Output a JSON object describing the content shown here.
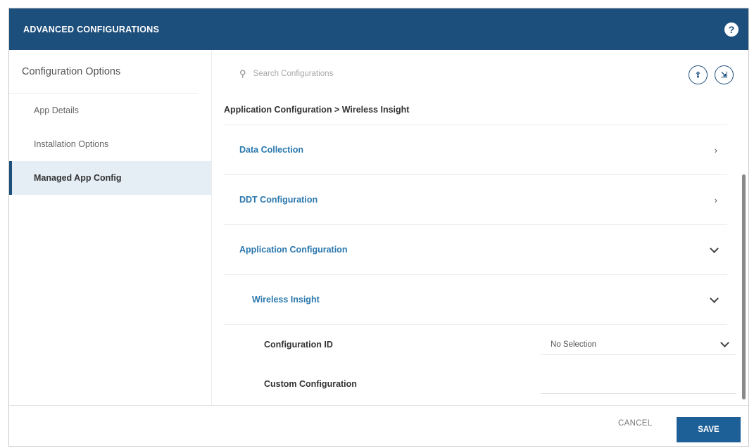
{
  "dialog": {
    "title": "ADVANCED CONFIGURATIONS",
    "help_icon": "question-circle-icon",
    "header_color": "#1d4f7c"
  },
  "sidebar": {
    "heading": "Configuration Options",
    "items": [
      {
        "label": "App Details",
        "active": false
      },
      {
        "label": "Installation Options",
        "active": false
      },
      {
        "label": "Managed App Config",
        "active": true
      }
    ]
  },
  "search": {
    "placeholder": "Search Configurations",
    "icon": "search-icon"
  },
  "toolbar": {
    "upload_icon": "upload-icon",
    "upload_glyph": "⇪",
    "export_icon": "export-icon",
    "export_glyph": "⇲"
  },
  "breadcrumb": "Application Configuration > Wireless Insight",
  "sections": [
    {
      "label": "Data Collection",
      "state": "collapsed",
      "chevron": "›"
    },
    {
      "label": "DDT Configuration",
      "state": "collapsed",
      "chevron": "›"
    },
    {
      "label": "Application Configuration",
      "state": "expanded"
    }
  ],
  "subsection": {
    "label": "Wireless Insight",
    "state": "expanded"
  },
  "fields": {
    "configuration_id": {
      "label": "Configuration ID",
      "value": "No Selection"
    },
    "custom_configuration": {
      "label": "Custom Configuration",
      "value": ""
    }
  },
  "footer": {
    "cancel_label": "CANCEL",
    "save_label": "SAVE"
  },
  "colors": {
    "accent": "#1d4f7c",
    "link": "#2a77ad",
    "save_button": "#1d5f97",
    "active_sidebar_bg": "#e5edf5"
  }
}
